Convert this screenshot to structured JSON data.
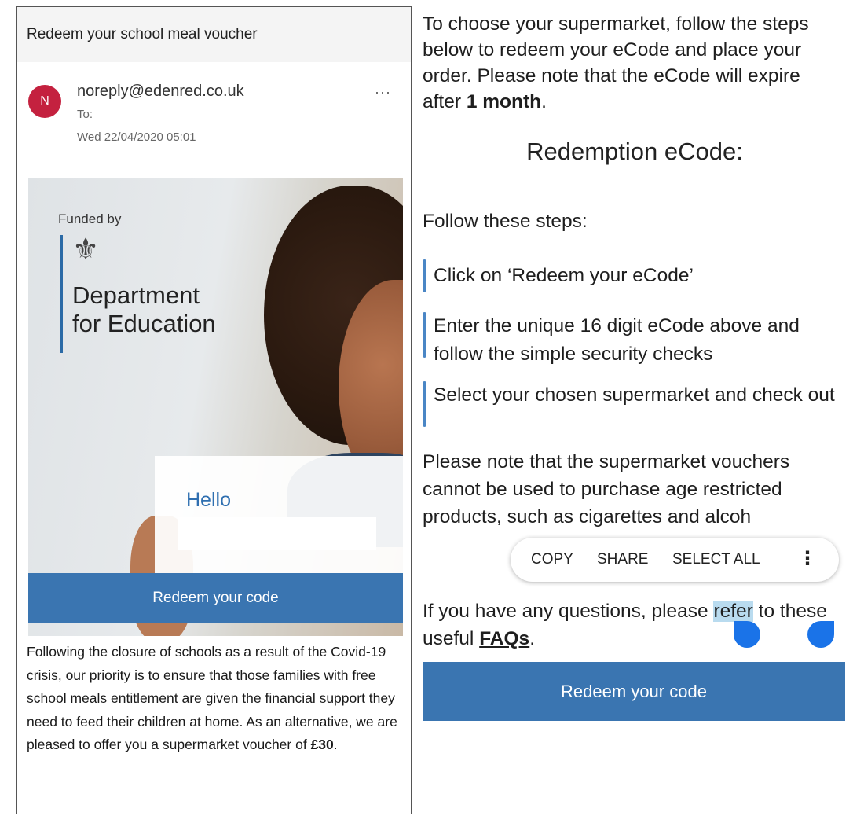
{
  "email": {
    "subject": "Redeem your school meal voucher",
    "avatar_letter": "N",
    "sender": "noreply@edenred.co.uk",
    "more_label": "···",
    "to_label": "To:",
    "date": "Wed 22/04/2020 05:01"
  },
  "hero": {
    "funded_by": "Funded by",
    "dept_line1": "Department",
    "dept_line2": "for Education",
    "greeting": "Hello",
    "redeem_button": "Redeem your code"
  },
  "body_left": {
    "text": "Following the closure of schools as a result of the Covid-19 crisis, our priority is to ensure that those families with free school meals entitlement are given the financial support they need to feed their children at home. As an alternative, we are pleased to offer you a supermarket voucher of ",
    "amount": "£30",
    "end": "."
  },
  "right": {
    "intro": "To choose your supermarket, follow the steps below to redeem your eCode and place your order. Please note that the eCode will expire after ",
    "intro_bold": "1 month",
    "intro_end": ".",
    "code_title": "Redemption eCode:",
    "follow": "Follow these steps:",
    "step1": "Click on ‘Redeem your eCode’",
    "step2": "Enter the unique 16 digit eCode above and follow the simple security checks",
    "step3": "Select your chosen supermarket and check out",
    "note_text": "Please note that the supermarket vouchers cannot be used to purchase age restricted products, such as cigarettes and alcoh",
    "questions_pre": "If you have any questions, please ",
    "questions_hl": "refer",
    "questions_post": " to these useful ",
    "faq": "FAQs",
    "faq_end": ".",
    "redeem_button": "Redeem your code"
  },
  "context_menu": {
    "copy": "COPY",
    "share": "SHARE",
    "select_all": "SELECT ALL",
    "more": "⋮"
  },
  "colors": {
    "accent_blue": "#3a75b1",
    "avatar_red": "#c4213f",
    "selection_handle": "#1a73e8",
    "highlight": "#b9dbef"
  }
}
